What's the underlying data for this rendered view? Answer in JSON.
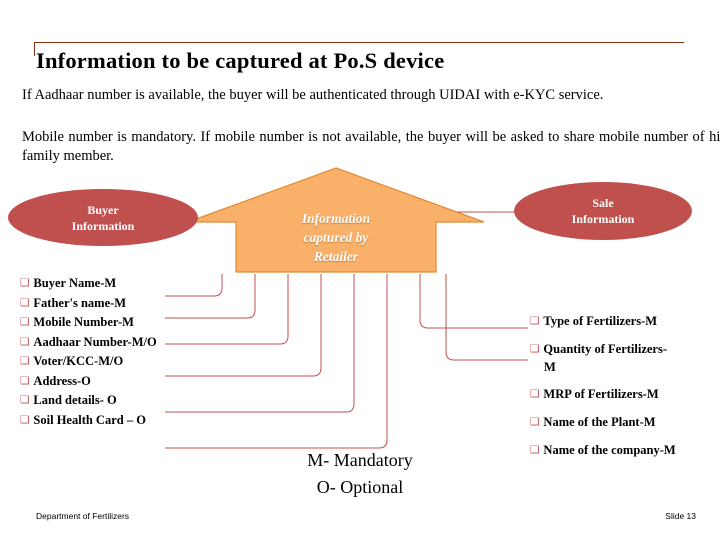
{
  "slide": {
    "title": "Information to be captured at Po.S device",
    "paragraph_1": "If Aadhaar number is available, the buyer will be authenticated through UIDAI with e-KYC service.",
    "paragraph_2": "Mobile number is mandatory. If mobile number is not available, the buyer will be asked to share mobile number of his family member.",
    "house_label_line1": "Information",
    "house_label_line2": "captured by",
    "house_label_line3": "Retailer",
    "left_pill_line1": "Buyer",
    "left_pill_line2": "Information",
    "right_pill_line1": "Sale",
    "right_pill_line2": "Information",
    "buyer_items": [
      "Buyer Name-M",
      "Father's name-M",
      "Mobile Number-M",
      "Aadhaar Number-M/O",
      "Voter/KCC-M/O",
      "Address-O",
      "Land details- O",
      "Soil Health Card – O"
    ],
    "sale_items": [
      "Type of Fertilizers-M",
      "Quantity of Fertilizers-",
      "MRP of Fertilizers-M",
      "Name of the Plant-M",
      "Name of the company-M"
    ],
    "sale_item_2_continuation": "M",
    "legend_mandatory": "M- Mandatory",
    "legend_optional": "O- Optional",
    "footer_left": "Department of Fertilizers",
    "footer_right": "Slide 13",
    "colors": {
      "pill_fill": "#c0504d",
      "house_fill": "#f9b169",
      "house_stroke": "#e38a33",
      "accent_rule": "#8a2f14",
      "connector": "#c0504d"
    }
  }
}
